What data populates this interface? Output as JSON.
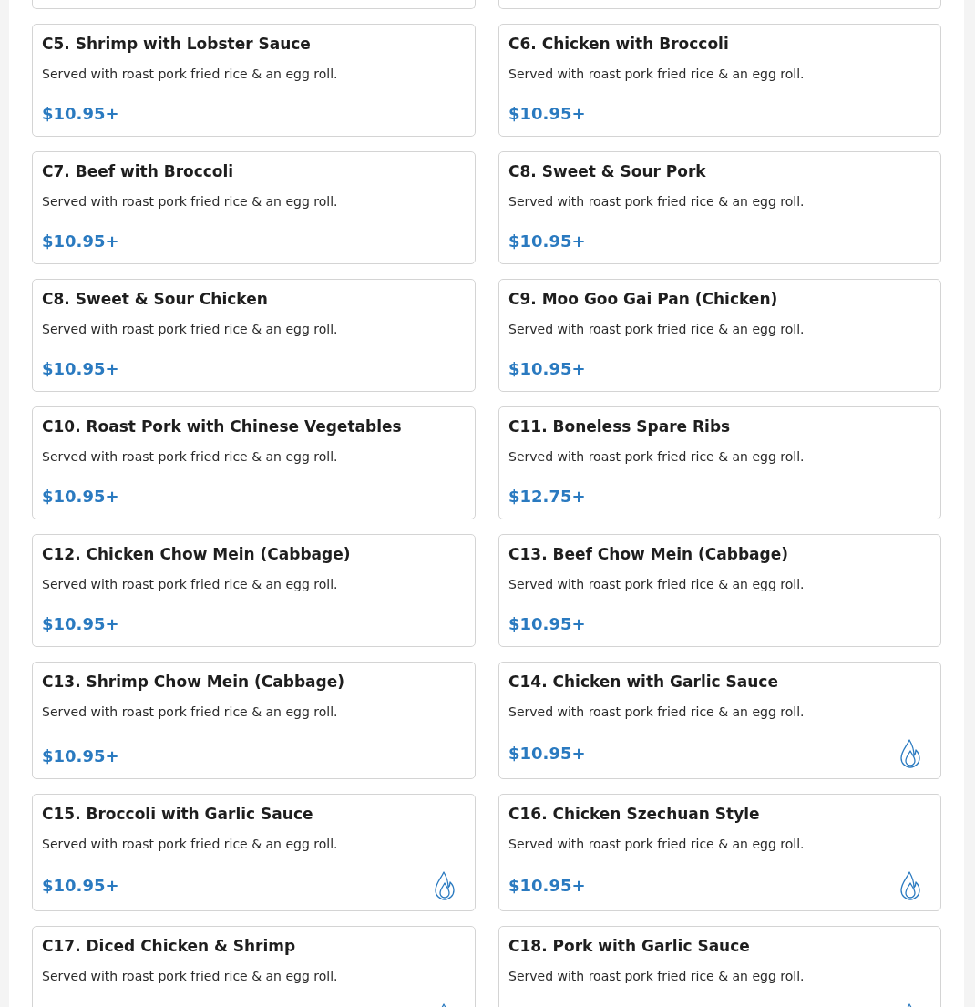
{
  "items": [
    {
      "title": "C5. Shrimp with Lobster Sauce",
      "description": "Served with roast pork fried rice & an egg roll.",
      "price": "$10.95+",
      "spicy": false
    },
    {
      "title": "C6. Chicken with Broccoli",
      "description": "Served with roast pork fried rice & an egg roll.",
      "price": "$10.95+",
      "spicy": false
    },
    {
      "title": "C7. Beef with Broccoli",
      "description": "Served with roast pork fried rice & an egg roll.",
      "price": "$10.95+",
      "spicy": false
    },
    {
      "title": "C8. Sweet & Sour Pork",
      "description": "Served with roast pork fried rice & an egg roll.",
      "price": "$10.95+",
      "spicy": false
    },
    {
      "title": "C8. Sweet & Sour Chicken",
      "description": "Served with roast pork fried rice & an egg roll.",
      "price": "$10.95+",
      "spicy": false
    },
    {
      "title": "C9. Moo Goo Gai Pan (Chicken)",
      "description": "Served with roast pork fried rice & an egg roll.",
      "price": "$10.95+",
      "spicy": false
    },
    {
      "title": "C10. Roast Pork with Chinese Vegetables",
      "description": "Served with roast pork fried rice & an egg roll.",
      "price": "$10.95+",
      "spicy": false
    },
    {
      "title": "C11. Boneless Spare Ribs",
      "description": "Served with roast pork fried rice & an egg roll.",
      "price": "$12.75+",
      "spicy": false
    },
    {
      "title": "C12. Chicken Chow Mein (Cabbage)",
      "description": "Served with roast pork fried rice & an egg roll.",
      "price": "$10.95+",
      "spicy": false
    },
    {
      "title": "C13. Beef Chow Mein (Cabbage)",
      "description": "Served with roast pork fried rice & an egg roll.",
      "price": "$10.95+",
      "spicy": false
    },
    {
      "title": "C13. Shrimp Chow Mein (Cabbage)",
      "description": "Served with roast pork fried rice & an egg roll.",
      "price": "$10.95+",
      "spicy": false
    },
    {
      "title": "C14. Chicken with Garlic Sauce",
      "description": "Served with roast pork fried rice & an egg roll.",
      "price": "$10.95+",
      "spicy": true
    },
    {
      "title": "C15. Broccoli with Garlic Sauce",
      "description": "Served with roast pork fried rice & an egg roll.",
      "price": "$10.95+",
      "spicy": true
    },
    {
      "title": "C16. Chicken Szechuan Style",
      "description": "Served with roast pork fried rice & an egg roll.",
      "price": "$10.95+",
      "spicy": true
    },
    {
      "title": "C17. Diced Chicken & Shrimp",
      "description": "Served with roast pork fried rice & an egg roll.",
      "spicy": true
    },
    {
      "title": "C18. Pork with Garlic Sauce",
      "description": "Served with roast pork fried rice & an egg roll.",
      "spicy": true
    }
  ]
}
